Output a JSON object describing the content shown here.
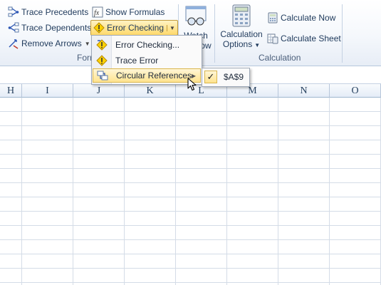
{
  "ribbon": {
    "trace_precedents": "Trace Precedents",
    "trace_dependents": "Trace Dependents",
    "remove_arrows": "Remove Arrows",
    "show_formulas": "Show Formulas",
    "error_checking": "Error Checking",
    "watch_window_top": "Watch",
    "watch_window_bottom": "Window",
    "calculation_options_line1": "Calculation",
    "calculation_options_line2": "Options",
    "calculate_now": "Calculate Now",
    "calculate_sheet": "Calculate Sheet",
    "group_formula_auditing": "Formula Auditing",
    "group_calculation": "Calculation"
  },
  "error_menu": {
    "items": [
      {
        "label": "Error Checking...",
        "icon": "error-check-icon"
      },
      {
        "label": "Trace Error",
        "icon": "trace-error-icon"
      },
      {
        "label": "Circular References",
        "icon": "circular-ref-icon"
      }
    ]
  },
  "circular_submenu": {
    "items": [
      {
        "label": "$A$9",
        "checked": true
      }
    ]
  },
  "columns": [
    "H",
    "I",
    "J",
    "K",
    "L",
    "M",
    "N",
    "O"
  ],
  "colors": {
    "accent": "#ffd96b",
    "ribbon_text": "#1e395b",
    "grid": "#d4dce7"
  }
}
